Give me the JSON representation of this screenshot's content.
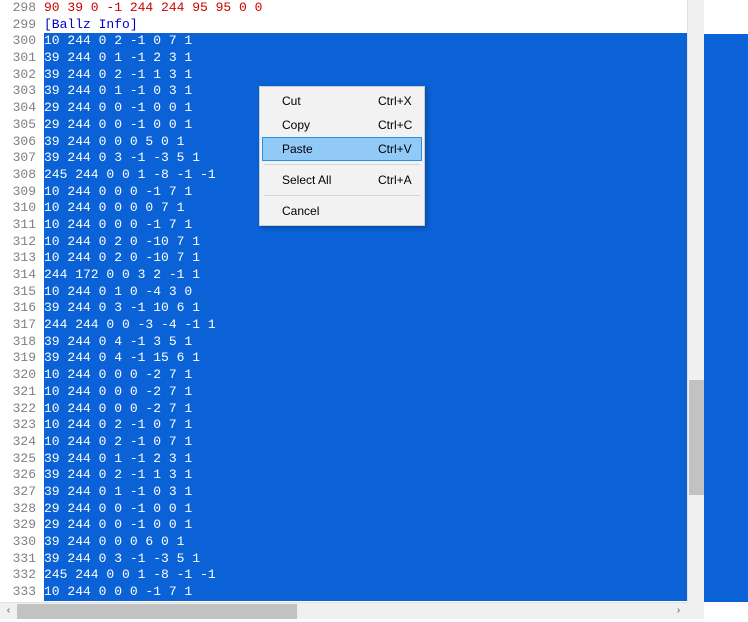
{
  "lines": [
    {
      "num": 298,
      "text": "90 39 0 -1 244 244 95 95 0 0",
      "style": "red",
      "selected": false
    },
    {
      "num": 299,
      "text": "[Ballz Info]",
      "style": "blue",
      "selected": false
    },
    {
      "num": 300,
      "text": "10 244 0 2 -1 0 7 1",
      "style": "plain",
      "selected": true
    },
    {
      "num": 301,
      "text": "39 244 0 1 -1 2 3 1",
      "style": "plain",
      "selected": true
    },
    {
      "num": 302,
      "text": "39 244 0 2 -1 1 3 1",
      "style": "plain",
      "selected": true
    },
    {
      "num": 303,
      "text": "39 244 0 1 -1 0 3 1",
      "style": "plain",
      "selected": true
    },
    {
      "num": 304,
      "text": "29 244 0 0 -1 0 0 1",
      "style": "plain",
      "selected": true
    },
    {
      "num": 305,
      "text": "29 244 0 0 -1 0 0 1",
      "style": "plain",
      "selected": true
    },
    {
      "num": 306,
      "text": "39 244 0 0 0 5 0 1",
      "style": "plain",
      "selected": true
    },
    {
      "num": 307,
      "text": "39 244 0 3 -1 -3 5 1",
      "style": "plain",
      "selected": true
    },
    {
      "num": 308,
      "text": "245 244 0 0 1 -8 -1 -1",
      "style": "plain",
      "selected": true
    },
    {
      "num": 309,
      "text": "10 244 0 0 0 -1 7 1",
      "style": "plain",
      "selected": true
    },
    {
      "num": 310,
      "text": "10 244 0 0 0 0 7 1",
      "style": "plain",
      "selected": true
    },
    {
      "num": 311,
      "text": "10 244 0 0 0 -1 7 1",
      "style": "plain",
      "selected": true
    },
    {
      "num": 312,
      "text": "10 244 0 2 0 -10 7 1",
      "style": "plain",
      "selected": true
    },
    {
      "num": 313,
      "text": "10 244 0 2 0 -10 7 1",
      "style": "plain",
      "selected": true
    },
    {
      "num": 314,
      "text": "244 172 0 0 3 2 -1 1",
      "style": "plain",
      "selected": true
    },
    {
      "num": 315,
      "text": "10 244 0 1 0 -4 3 0",
      "style": "plain",
      "selected": true
    },
    {
      "num": 316,
      "text": "39 244 0 3 -1 10 6 1",
      "style": "plain",
      "selected": true
    },
    {
      "num": 317,
      "text": "244 244 0 0 -3 -4 -1 1",
      "style": "plain",
      "selected": true
    },
    {
      "num": 318,
      "text": "39 244 0 4 -1 3 5 1",
      "style": "plain",
      "selected": true
    },
    {
      "num": 319,
      "text": "39 244 0 4 -1 15 6 1",
      "style": "plain",
      "selected": true
    },
    {
      "num": 320,
      "text": "10 244 0 0 0 -2 7 1",
      "style": "plain",
      "selected": true
    },
    {
      "num": 321,
      "text": "10 244 0 0 0 -2 7 1",
      "style": "plain",
      "selected": true
    },
    {
      "num": 322,
      "text": "10 244 0 0 0 -2 7 1",
      "style": "plain",
      "selected": true
    },
    {
      "num": 323,
      "text": "10 244 0 2 -1 0 7 1",
      "style": "plain",
      "selected": true
    },
    {
      "num": 324,
      "text": "10 244 0 2 -1 0 7 1",
      "style": "plain",
      "selected": true
    },
    {
      "num": 325,
      "text": "39 244 0 1 -1 2 3 1",
      "style": "plain",
      "selected": true
    },
    {
      "num": 326,
      "text": "39 244 0 2 -1 1 3 1",
      "style": "plain",
      "selected": true
    },
    {
      "num": 327,
      "text": "39 244 0 1 -1 0 3 1",
      "style": "plain",
      "selected": true
    },
    {
      "num": 328,
      "text": "29 244 0 0 -1 0 0 1",
      "style": "plain",
      "selected": true
    },
    {
      "num": 329,
      "text": "29 244 0 0 -1 0 0 1",
      "style": "plain",
      "selected": true
    },
    {
      "num": 330,
      "text": "39 244 0 0 0 6 0 1",
      "style": "plain",
      "selected": true
    },
    {
      "num": 331,
      "text": "39 244 0 3 -1 -3 5 1",
      "style": "plain",
      "selected": true
    },
    {
      "num": 332,
      "text": "245 244 0 0 1 -8 -1 -1",
      "style": "plain",
      "selected": true
    },
    {
      "num": 333,
      "text": "10 244 0 0 0 -1 7 1",
      "style": "plain",
      "selected": true
    }
  ],
  "context_menu": {
    "items": [
      {
        "label": "Cut",
        "shortcut": "Ctrl+X",
        "highlight": false
      },
      {
        "label": "Copy",
        "shortcut": "Ctrl+C",
        "highlight": false
      },
      {
        "label": "Paste",
        "shortcut": "Ctrl+V",
        "highlight": true
      }
    ],
    "items2": [
      {
        "label": "Select All",
        "shortcut": "Ctrl+A",
        "highlight": false
      }
    ],
    "items3": [
      {
        "label": "Cancel",
        "shortcut": "",
        "highlight": false
      }
    ]
  },
  "hscroll_arrows": {
    "left": "‹",
    "right": "›"
  }
}
